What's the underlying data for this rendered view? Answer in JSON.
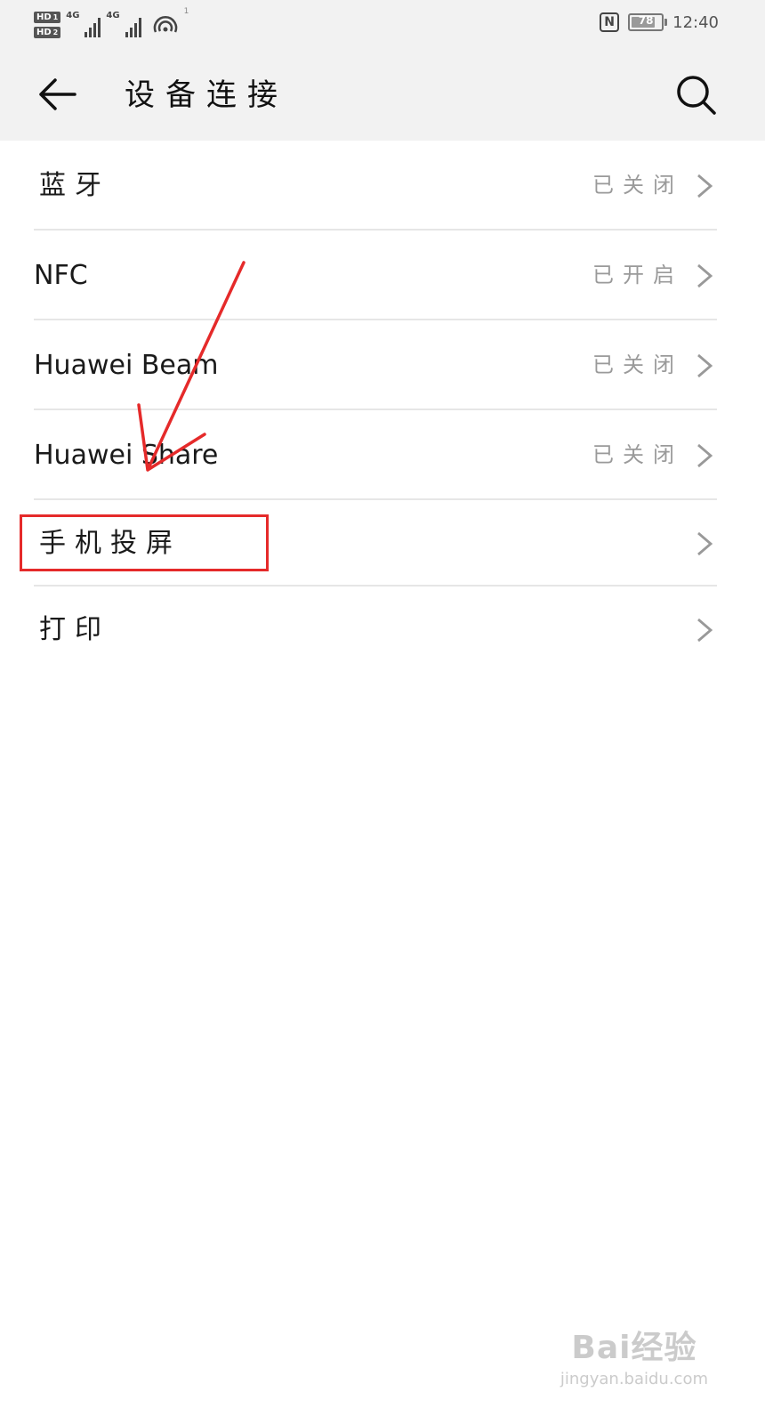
{
  "status_bar": {
    "hd1": "HD",
    "hd1_sub": "1",
    "hd2": "HD",
    "hd2_sub": "2",
    "network1": "4G",
    "network2": "4G",
    "hotspot_count": "1",
    "nfc_icon": "nfc-icon",
    "battery_level": "78",
    "time": "12:40"
  },
  "app_bar": {
    "title": "设备连接",
    "back_icon": "arrow-left-icon",
    "search_icon": "search-icon"
  },
  "settings": [
    {
      "label": "蓝牙",
      "status": "已关闭"
    },
    {
      "label": "NFC",
      "status": "已开启"
    },
    {
      "label": "Huawei Beam",
      "status": "已关闭"
    },
    {
      "label": "Huawei Share",
      "status": "已关闭"
    },
    {
      "label": "手机投屏",
      "status": ""
    },
    {
      "label": "打印",
      "status": ""
    }
  ],
  "annotation": {
    "color": "#e52a2a",
    "highlighted_item": "手机投屏"
  },
  "watermark": {
    "logo": "Bai经验",
    "url": "jingyan.baidu.com"
  }
}
